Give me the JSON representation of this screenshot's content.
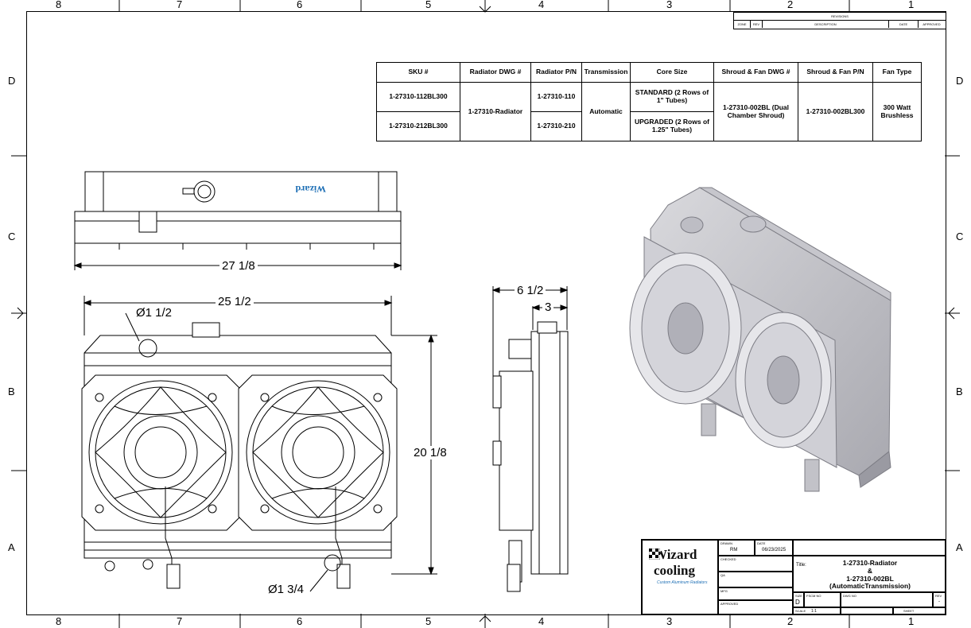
{
  "border": {
    "columns": [
      "8",
      "7",
      "6",
      "5",
      "4",
      "3",
      "2",
      "1"
    ],
    "rows": [
      "D",
      "C",
      "B",
      "A"
    ]
  },
  "revisions": {
    "title": "REVISIONS",
    "headers": [
      "ZONE",
      "REV",
      "DESCRIPTION",
      "DATE",
      "APPROVED"
    ]
  },
  "spec_table": {
    "headers": [
      "SKU #",
      "Radiator DWG #",
      "Radiator P/N",
      "Transmission",
      "Core Size",
      "Shroud & Fan DWG #",
      "Shroud & Fan P/N",
      "Fan Type"
    ],
    "sku": [
      "1-27310-112BL300",
      "1-27310-212BL300"
    ],
    "radiator_dwg": "1-27310-Radiator",
    "radiator_pn": [
      "1-27310-110",
      "1-27310-210"
    ],
    "transmission": "Automatic",
    "core_size": [
      "STANDARD (2 Rows of 1\" Tubes)",
      "UPGRADED (2 Rows of 1.25\" Tubes)"
    ],
    "shroud_dwg": "1-27310-002BL (Dual Chamber Shroud)",
    "shroud_pn": "1-27310-002BL300",
    "fan_type": "300 Watt Brushless"
  },
  "dimensions": {
    "overall_width": "27 1/8",
    "core_width": "25 1/2",
    "inlet_diameter": "Ø1 1/2",
    "height": "20 1/8",
    "outlet_diameter": "Ø1 3/4",
    "depth_overall": "6 1/2",
    "depth_core": "3"
  },
  "logo": {
    "brand": "Wizard cooling",
    "tagline": "Custom Aluminum Radiators"
  },
  "title_block": {
    "drawn_label": "DRAWN",
    "drawn_by": "RM",
    "date_label": "DATE",
    "date": "06/23/2025",
    "checked_label": "CHECKED",
    "qa_label": "QA",
    "mfg_label": "MFG",
    "approved_label": "APPROVED",
    "title_label": "Title:",
    "title_lines": [
      "1-27310-Radiator",
      "&",
      "1-27310-002BL",
      "(AutomaticTransmission)"
    ],
    "size_label": "SIZE",
    "size": "D",
    "fscm_label": "FSCM NO",
    "dwg_label": "DWG NO",
    "rev_label": "REV",
    "rev": "-",
    "scale_label": "SCALE",
    "scale": "1:1",
    "sheet_label": "SHEET"
  }
}
